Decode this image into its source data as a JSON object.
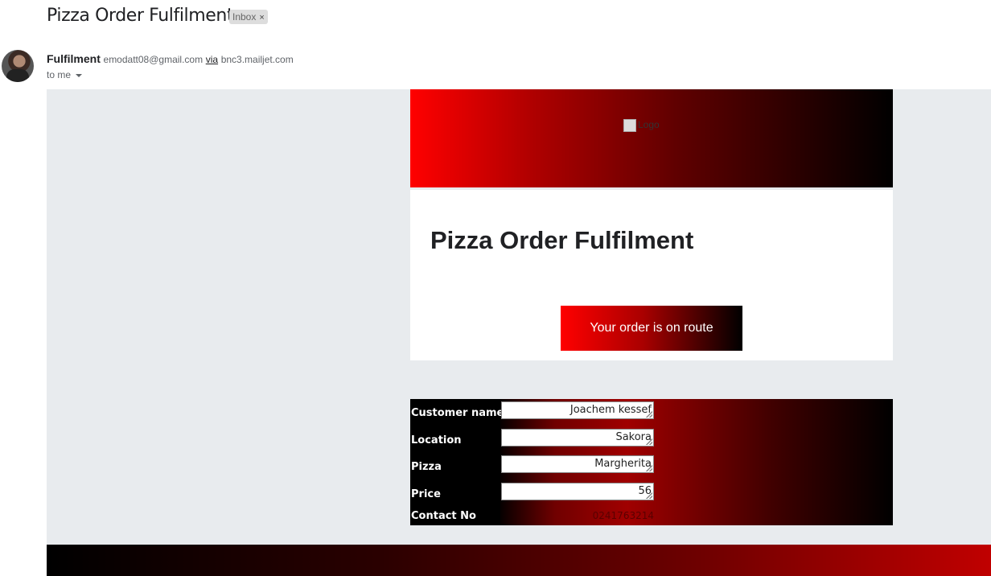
{
  "email": {
    "subject": "Pizza Order Fulfilment",
    "label": "Inbox",
    "label_close": "×",
    "sender_name": "Fulfilment",
    "sender_email": "emodatt08@gmail.com",
    "via_text": "via",
    "via_domain": "bnc3.mailjet.com",
    "recipient": "to me"
  },
  "content": {
    "logo_alt": "Logo",
    "heading": "Pizza Order Fulfilment",
    "cta_label": "Your order is on route",
    "fields": [
      {
        "label": "Customer name",
        "value": "Joachem kessef"
      },
      {
        "label": "Location",
        "value": "Sakora"
      },
      {
        "label": "Pizza",
        "value": "Margherita"
      },
      {
        "label": "Price",
        "value": "56"
      }
    ],
    "contact_label": "Contact No",
    "contact_value": "0241763214"
  },
  "colors": {
    "brand_red": "#ff0000",
    "dark": "#000000",
    "canvas": "#e8ebee"
  }
}
